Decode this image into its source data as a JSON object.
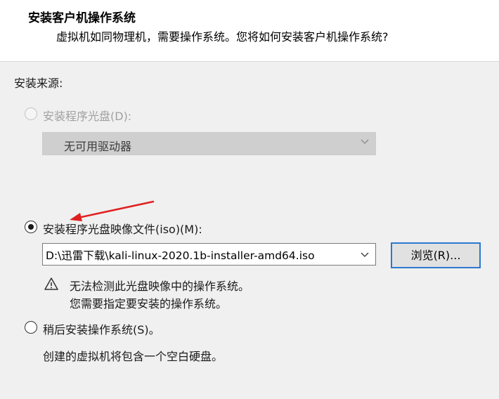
{
  "header": {
    "title": "安装客户机操作系统",
    "subtitle": "虚拟机如同物理机，需要操作系统。您将如何安装客户机操作系统?"
  },
  "install_source_label": "安装来源:",
  "options": {
    "disc": {
      "label": "安装程序光盘(D):",
      "selected": false,
      "enabled": false,
      "dropdown_value": "无可用驱动器"
    },
    "iso": {
      "label": "安装程序光盘映像文件(iso)(M):",
      "selected": true,
      "path_value": "D:\\迅雷下载\\kali-linux-2020.1b-installer-amd64.iso",
      "browse_label": "浏览(R)...",
      "warning_line1": "无法检测此光盘映像中的操作系统。",
      "warning_line2": "您需要指定要安装的操作系统。"
    },
    "later": {
      "label": "稍后安装操作系统(S)。",
      "selected": false,
      "description": "创建的虚拟机将包含一个空白硬盘。"
    }
  },
  "colors": {
    "accent": "#2b78d0",
    "annotation_arrow": "#e02020"
  },
  "icons": [
    "chevron-down-icon",
    "warning-icon",
    "annotation-arrow"
  ]
}
